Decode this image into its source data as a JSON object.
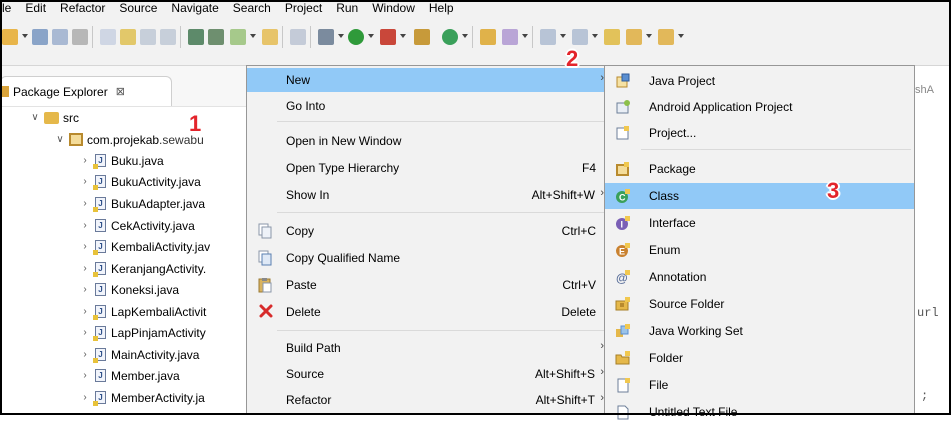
{
  "menubar": {
    "items": [
      "le",
      "Edit",
      "Refactor",
      "Source",
      "Navigate",
      "Search",
      "Project",
      "Run",
      "Window",
      "Help"
    ]
  },
  "explorer": {
    "tab_label": "Package Explorer",
    "tab_close": "⊠",
    "tree": {
      "src_label": "src",
      "package_label": "com.projekab",
      "package_label_tail": ".sewabu",
      "files": [
        "Buku.java",
        "BukuActivity.java",
        "BukuAdapter.java",
        "CekActivity.java",
        "KembaliActivity.jav",
        "KeranjangActivity.",
        "Koneksi.java",
        "LapKembaliActivit",
        "LapPinjamActivity",
        "MainActivity.java",
        "Member.java",
        "MemberActivity.ja"
      ]
    }
  },
  "editor": {
    "tab_fragment": "shA",
    "code_fragment_1": "url",
    "code_fragment_2": ";"
  },
  "context_menu": {
    "items": [
      {
        "label": "New",
        "shortcut": "",
        "submenu": true,
        "selected": true,
        "icon": ""
      },
      {
        "label": "Go Into",
        "shortcut": "",
        "submenu": false,
        "icon": ""
      },
      {
        "label": "Open in New Window",
        "shortcut": "",
        "submenu": false,
        "icon": ""
      },
      {
        "label": "Open Type Hierarchy",
        "shortcut": "F4",
        "submenu": false,
        "icon": ""
      },
      {
        "label": "Show In",
        "shortcut": "Alt+Shift+W",
        "submenu": true,
        "icon": ""
      },
      {
        "label": "Copy",
        "shortcut": "Ctrl+C",
        "submenu": false,
        "icon": "copy-icon"
      },
      {
        "label": "Copy Qualified Name",
        "shortcut": "",
        "submenu": false,
        "icon": "copy-qualified-icon"
      },
      {
        "label": "Paste",
        "shortcut": "Ctrl+V",
        "submenu": false,
        "icon": "paste-icon"
      },
      {
        "label": "Delete",
        "shortcut": "Delete",
        "submenu": false,
        "icon": "delete-icon"
      },
      {
        "label": "Build Path",
        "shortcut": "",
        "submenu": true,
        "icon": ""
      },
      {
        "label": "Source",
        "shortcut": "Alt+Shift+S",
        "submenu": true,
        "icon": ""
      },
      {
        "label": "Refactor",
        "shortcut": "Alt+Shift+T",
        "submenu": true,
        "icon": ""
      }
    ]
  },
  "submenu": {
    "items": [
      {
        "label": "Java Project",
        "icon": "java-project-icon"
      },
      {
        "label": "Android Application Project",
        "icon": "android-project-icon"
      },
      {
        "label": "Project...",
        "icon": "project-icon"
      },
      {
        "label": "Package",
        "icon": "package-icon"
      },
      {
        "label": "Class",
        "icon": "class-icon",
        "selected": true
      },
      {
        "label": "Interface",
        "icon": "interface-icon"
      },
      {
        "label": "Enum",
        "icon": "enum-icon"
      },
      {
        "label": "Annotation",
        "icon": "annotation-icon"
      },
      {
        "label": "Source Folder",
        "icon": "source-folder-icon"
      },
      {
        "label": "Java Working Set",
        "icon": "working-set-icon"
      },
      {
        "label": "Folder",
        "icon": "folder-icon"
      },
      {
        "label": "File",
        "icon": "file-icon"
      },
      {
        "label": "Untitled Text File",
        "icon": "text-file-icon"
      }
    ]
  },
  "markers": {
    "one": "1",
    "two": "2",
    "three": "3"
  },
  "colors": {
    "selection": "#91c9f7",
    "marker": "#e3242b",
    "menu_bg": "#f2f2f2"
  }
}
